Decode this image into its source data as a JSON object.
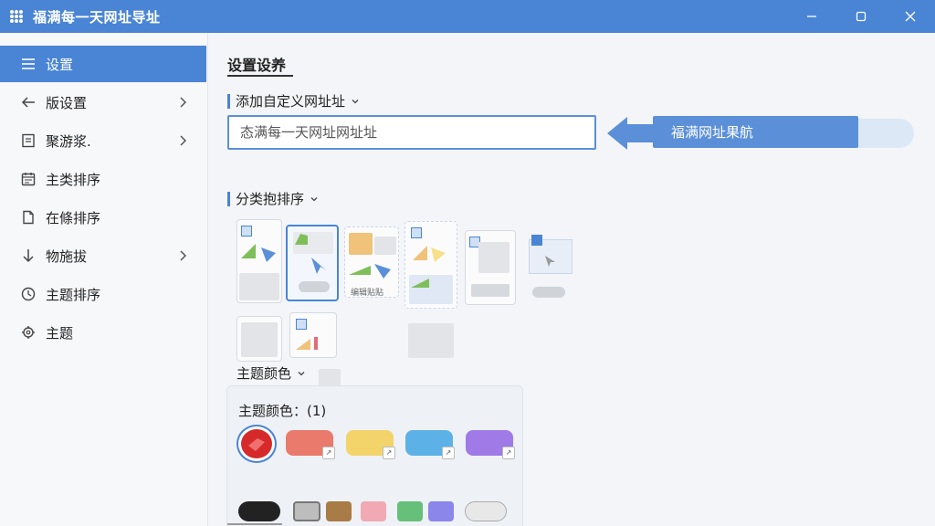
{
  "window": {
    "title": "福满每一天网址导址"
  },
  "sidebar": {
    "items": [
      {
        "label": "设置",
        "icon": "menu-icon",
        "active": true
      },
      {
        "label": "版设置",
        "icon": "arrow-left-icon",
        "has_chevron": true
      },
      {
        "label": "聚游浆.",
        "icon": "bookmark-icon",
        "has_chevron": true
      },
      {
        "label": "主类排序",
        "icon": "calendar-icon"
      },
      {
        "label": "在條排序",
        "icon": "document-icon"
      },
      {
        "label": "物施拔",
        "icon": "arrow-down-icon",
        "has_chevron": true
      },
      {
        "label": "主题排序",
        "icon": "clock-icon"
      },
      {
        "label": "主题",
        "icon": "palette-icon"
      }
    ]
  },
  "main": {
    "title": "设置设养",
    "add_url": {
      "label": "添加自定义网址址",
      "placeholder": "态满每一天网址网址址"
    },
    "callout": {
      "label": "福满网址果航"
    },
    "category_sort": {
      "label": "分类抱排序",
      "thumb_caption": "编辑贴贴"
    },
    "theme": {
      "label": "主题颜色",
      "panel_title": "主题颜色：(1)",
      "row1": [
        {
          "color": "#d62a2a",
          "kind": "selected"
        },
        {
          "color": "#ea7a6c"
        },
        {
          "color": "#f3d46a"
        },
        {
          "color": "#5cb2e6"
        },
        {
          "color": "#a07ae6"
        }
      ],
      "row2": [
        {
          "color": "#222222"
        },
        {
          "color": "#bdbdbd"
        },
        {
          "color": "#a87b47"
        },
        {
          "color": "#f1a9b4"
        },
        {
          "color": "#66c07a"
        },
        {
          "color": "#8a86ea"
        },
        {
          "color": "#e8e8e8"
        }
      ]
    }
  },
  "colors": {
    "accent": "#4a84d4",
    "titlebar": "#4a84d4"
  }
}
